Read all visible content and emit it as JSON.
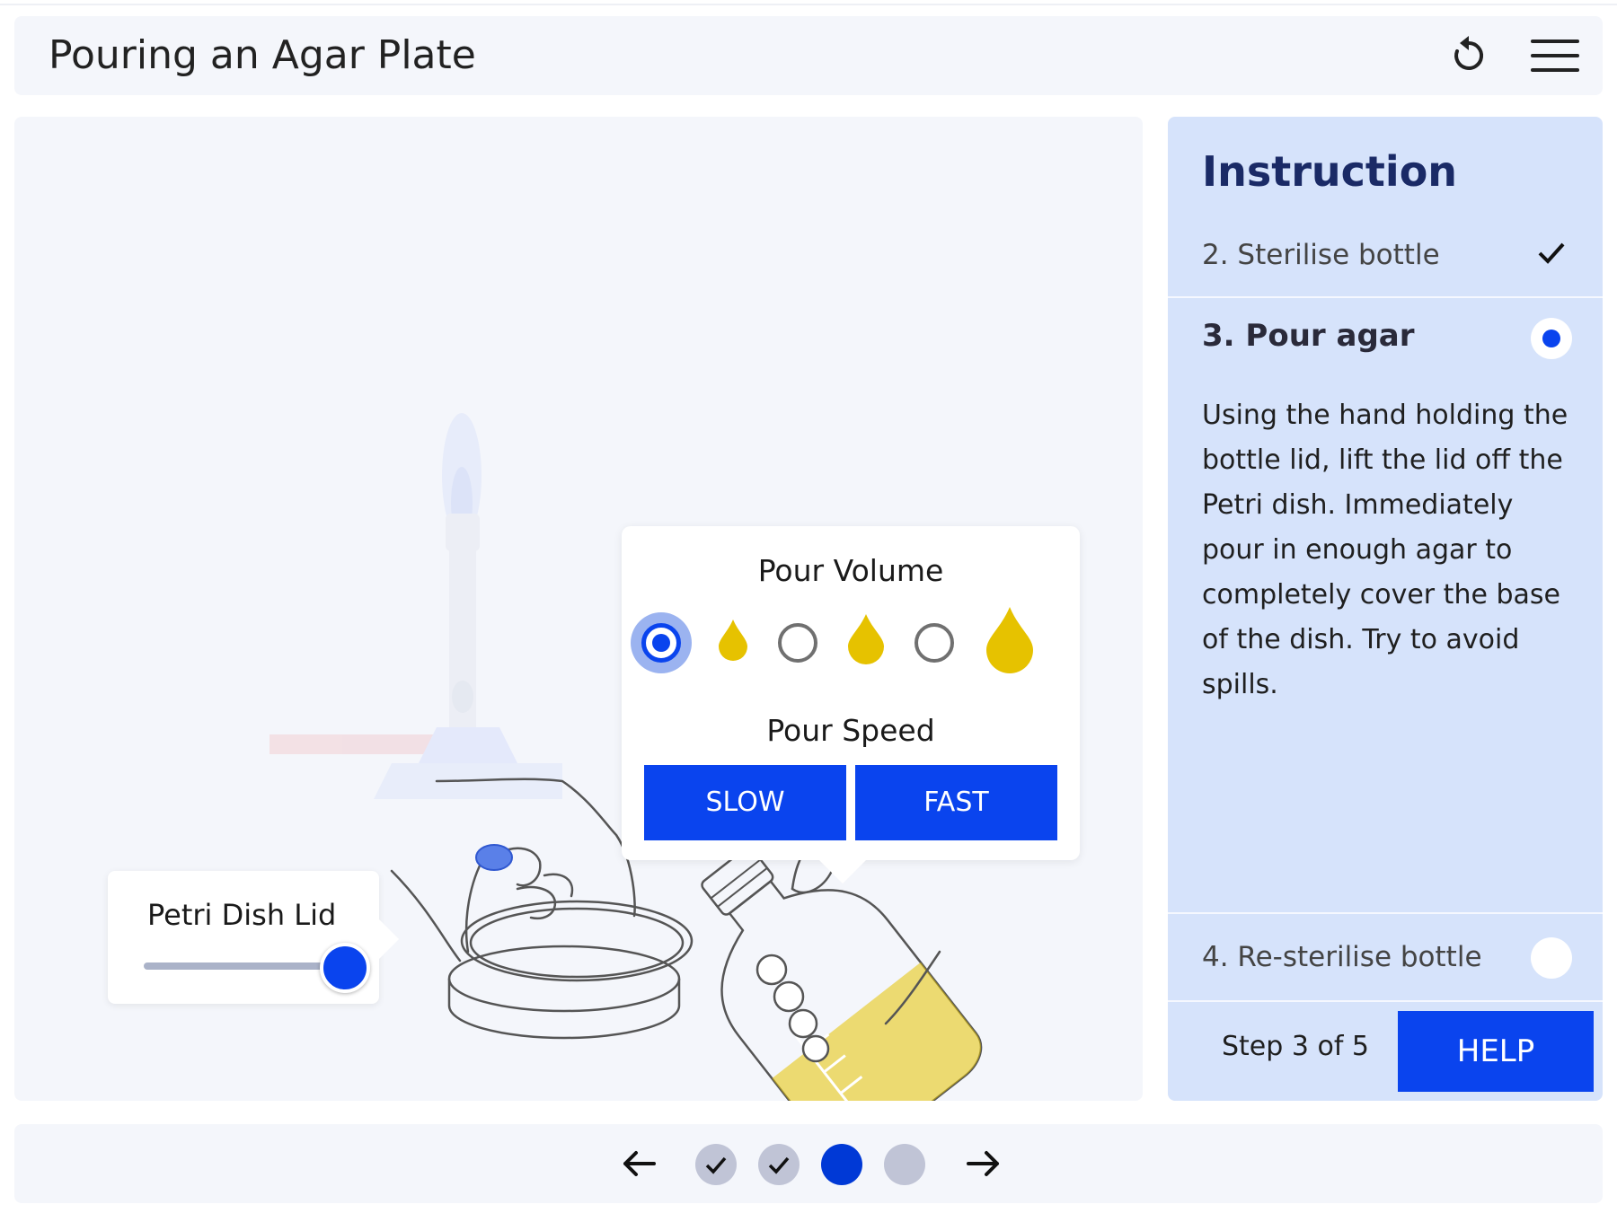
{
  "header": {
    "title": "Pouring an Agar Plate",
    "reset_icon": "restart-icon",
    "menu_icon": "hamburger-menu-icon"
  },
  "lid_control": {
    "label": "Petri Dish Lid",
    "slider_value": 1.0
  },
  "pour_panel": {
    "volume_title": "Pour Volume",
    "volume_options": [
      {
        "size": "small",
        "selected": true
      },
      {
        "size": "medium",
        "selected": false
      },
      {
        "size": "large",
        "selected": false
      }
    ],
    "speed_title": "Pour Speed",
    "slow_label": "SLOW",
    "fast_label": "FAST"
  },
  "instructions": {
    "title": "Instruction",
    "steps": [
      {
        "label": "2. Sterilise bottle",
        "status": "done"
      },
      {
        "label": "3. Pour agar",
        "status": "current",
        "body": "Using the hand holding the bottle lid, lift the lid off the Petri dish. Immediately pour in enough agar to completely cover the base of the dish. Try to avoid spills."
      },
      {
        "label": "4. Re-sterilise bottle",
        "status": "todo"
      }
    ],
    "step_counter": "Step 3 of 5",
    "help_label": "HELP"
  },
  "pagination": {
    "pages": [
      "done",
      "done",
      "current",
      "todo"
    ]
  },
  "colors": {
    "accent": "#0a44ee",
    "agar": "#e6c200",
    "panel": "#d6e3fb",
    "background": "#f4f6fb"
  }
}
